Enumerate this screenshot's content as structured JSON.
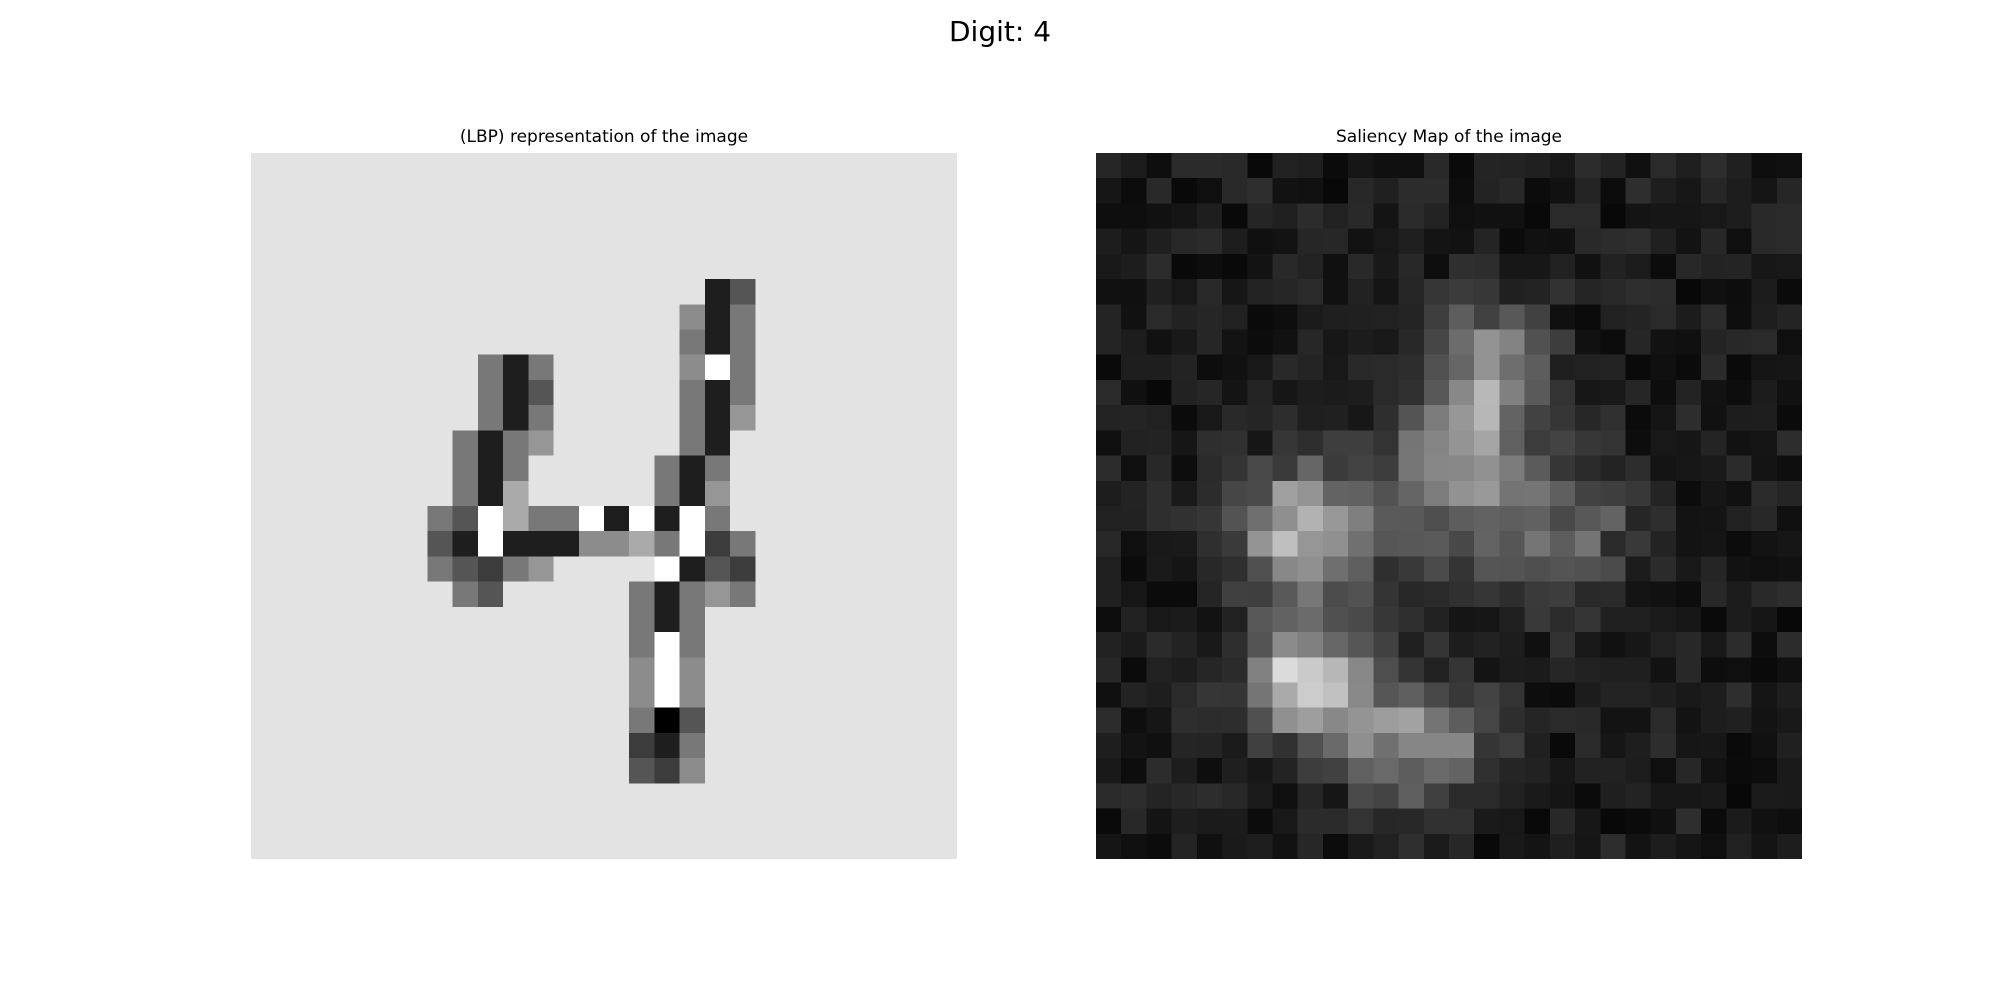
{
  "figure": {
    "suptitle": "Digit: 4"
  },
  "chart_data": [
    {
      "type": "heatmap",
      "title": "(LBP) representation of the image",
      "colormap": "gray",
      "vmin": 0,
      "vmax": 255,
      "axis": "off",
      "rows": 28,
      "cols": 28,
      "background": 227,
      "cells": [
        [
          5,
          18,
          30
        ],
        [
          5,
          19,
          85
        ],
        [
          6,
          17,
          140
        ],
        [
          6,
          18,
          30
        ],
        [
          6,
          19,
          120
        ],
        [
          7,
          17,
          120
        ],
        [
          7,
          18,
          30
        ],
        [
          7,
          19,
          120
        ],
        [
          8,
          9,
          120
        ],
        [
          8,
          10,
          30
        ],
        [
          8,
          11,
          120
        ],
        [
          8,
          17,
          140
        ],
        [
          8,
          18,
          255
        ],
        [
          8,
          19,
          120
        ],
        [
          9,
          9,
          120
        ],
        [
          9,
          10,
          30
        ],
        [
          9,
          11,
          85
        ],
        [
          9,
          17,
          120
        ],
        [
          9,
          18,
          30
        ],
        [
          9,
          19,
          120
        ],
        [
          10,
          9,
          120
        ],
        [
          10,
          10,
          30
        ],
        [
          10,
          11,
          120
        ],
        [
          10,
          17,
          120
        ],
        [
          10,
          18,
          30
        ],
        [
          10,
          19,
          150
        ],
        [
          11,
          8,
          120
        ],
        [
          11,
          9,
          30
        ],
        [
          11,
          10,
          120
        ],
        [
          11,
          11,
          150
        ],
        [
          11,
          17,
          120
        ],
        [
          11,
          18,
          30
        ],
        [
          12,
          8,
          120
        ],
        [
          12,
          9,
          30
        ],
        [
          12,
          10,
          120
        ],
        [
          12,
          16,
          120
        ],
        [
          12,
          17,
          30
        ],
        [
          12,
          18,
          120
        ],
        [
          13,
          8,
          120
        ],
        [
          13,
          9,
          30
        ],
        [
          13,
          10,
          170
        ],
        [
          13,
          16,
          120
        ],
        [
          13,
          17,
          30
        ],
        [
          13,
          18,
          150
        ],
        [
          14,
          7,
          120
        ],
        [
          14,
          8,
          85
        ],
        [
          14,
          9,
          255
        ],
        [
          14,
          10,
          170
        ],
        [
          14,
          11,
          120
        ],
        [
          14,
          12,
          120
        ],
        [
          14,
          13,
          255
        ],
        [
          14,
          14,
          30
        ],
        [
          14,
          15,
          255
        ],
        [
          14,
          16,
          30
        ],
        [
          14,
          17,
          255
        ],
        [
          14,
          18,
          120
        ],
        [
          15,
          7,
          85
        ],
        [
          15,
          8,
          30
        ],
        [
          15,
          9,
          255
        ],
        [
          15,
          10,
          30
        ],
        [
          15,
          11,
          30
        ],
        [
          15,
          12,
          30
        ],
        [
          15,
          13,
          140
        ],
        [
          15,
          14,
          140
        ],
        [
          15,
          15,
          170
        ],
        [
          15,
          16,
          120
        ],
        [
          15,
          17,
          255
        ],
        [
          15,
          18,
          60
        ],
        [
          15,
          19,
          120
        ],
        [
          16,
          7,
          120
        ],
        [
          16,
          8,
          85
        ],
        [
          16,
          9,
          60
        ],
        [
          16,
          10,
          120
        ],
        [
          16,
          11,
          150
        ],
        [
          16,
          16,
          255
        ],
        [
          16,
          17,
          30
        ],
        [
          16,
          18,
          85
        ],
        [
          16,
          19,
          60
        ],
        [
          17,
          8,
          120
        ],
        [
          17,
          9,
          85
        ],
        [
          17,
          15,
          120
        ],
        [
          17,
          16,
          30
        ],
        [
          17,
          17,
          120
        ],
        [
          17,
          18,
          150
        ],
        [
          17,
          19,
          120
        ],
        [
          18,
          15,
          120
        ],
        [
          18,
          16,
          30
        ],
        [
          18,
          17,
          120
        ],
        [
          19,
          15,
          120
        ],
        [
          19,
          16,
          255
        ],
        [
          19,
          17,
          120
        ],
        [
          20,
          15,
          140
        ],
        [
          20,
          16,
          255
        ],
        [
          20,
          17,
          140
        ],
        [
          21,
          15,
          140
        ],
        [
          21,
          16,
          255
        ],
        [
          21,
          17,
          140
        ],
        [
          22,
          15,
          120
        ],
        [
          22,
          16,
          0
        ],
        [
          22,
          17,
          85
        ],
        [
          23,
          15,
          60
        ],
        [
          23,
          16,
          30
        ],
        [
          23,
          17,
          120
        ],
        [
          24,
          15,
          85
        ],
        [
          24,
          16,
          60
        ],
        [
          24,
          17,
          140
        ]
      ]
    },
    {
      "type": "heatmap",
      "title": "Saliency Map of the image",
      "colormap": "gray",
      "vmin": 0,
      "vmax": 255,
      "axis": "off",
      "rows": 28,
      "cols": 28,
      "background": 8,
      "blobs": [
        {
          "row": 8,
          "col": 14.8,
          "sigma": 1.7,
          "value": 110
        },
        {
          "row": 11.5,
          "col": 14.2,
          "sigma": 1.5,
          "value": 115
        },
        {
          "row": 14.5,
          "col": 7.5,
          "sigma": 1.7,
          "value": 145
        },
        {
          "row": 14,
          "col": 12,
          "sigma": 2.2,
          "value": 55
        },
        {
          "row": 14.5,
          "col": 18,
          "sigma": 2.0,
          "value": 75
        },
        {
          "row": 20.5,
          "col": 8,
          "sigma": 1.7,
          "value": 175
        },
        {
          "row": 23,
          "col": 11.5,
          "sigma": 1.5,
          "value": 110
        },
        {
          "row": 22.5,
          "col": 14,
          "sigma": 1.4,
          "value": 60
        }
      ]
    }
  ]
}
